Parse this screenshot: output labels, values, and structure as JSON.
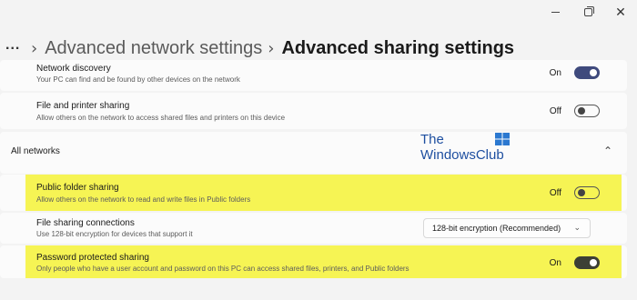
{
  "window": {
    "minimize_icon": "minimize-icon",
    "maximize_icon": "restore-icon",
    "close_glyph": "✕"
  },
  "breadcrumb": {
    "more": "...",
    "parent": "Advanced network settings",
    "current": "Advanced sharing settings"
  },
  "private_section": {
    "network_discovery": {
      "title": "Network discovery",
      "description": "Your PC can find and be found by other devices on the network",
      "state": "On"
    },
    "file_printer_sharing": {
      "title": "File and printer sharing",
      "description": "Allow others on the network to access shared files and printers on this device",
      "state": "Off"
    }
  },
  "all_networks": {
    "label": "All networks",
    "public_folder_sharing": {
      "title": "Public folder sharing",
      "description": "Allow others on the network to read and write files in Public folders",
      "state": "Off"
    },
    "file_sharing_connections": {
      "title": "File sharing connections",
      "description": "Use 128-bit encryption for devices that support it",
      "selected": "128-bit encryption (Recommended)"
    },
    "password_protected_sharing": {
      "title": "Password protected sharing",
      "description": "Only people who have a user account and password on this PC can access shared files, printers, and Public folders",
      "state": "On"
    }
  },
  "watermark": {
    "line1": "The",
    "line2": "WindowsClub"
  },
  "colors": {
    "highlight": "#f6f454",
    "toggle_on": "#3f4a7d",
    "logo_blue": "#1e4fa0"
  }
}
